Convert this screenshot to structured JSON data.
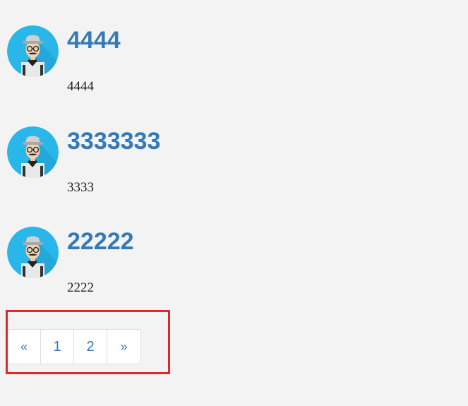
{
  "posts": [
    {
      "title": "4444",
      "body": "4444"
    },
    {
      "title": "3333333",
      "body": "3333"
    },
    {
      "title": "22222",
      "body": "2222"
    }
  ],
  "pagination": {
    "prev_label": "«",
    "pages": [
      "1",
      "2"
    ],
    "next_label": "»"
  },
  "icons": {
    "avatar": "hipster-man-avatar-icon"
  },
  "colors": {
    "link": "#337ab7",
    "background": "#f3f3f3",
    "avatar_bg": "#29b6e8",
    "highlight": "#e0282a"
  }
}
